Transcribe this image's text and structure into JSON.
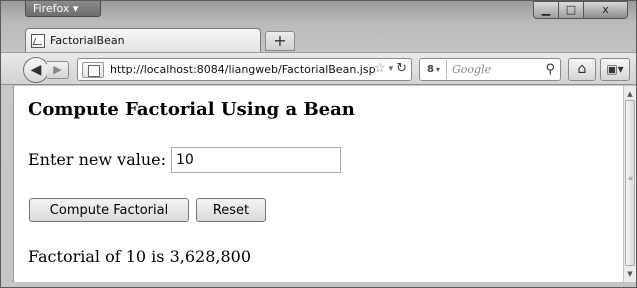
{
  "browser": {
    "app_menu_label": "Firefox ▾",
    "window_controls": {
      "minimize": "▁",
      "maximize": "□",
      "close": "x"
    },
    "tab_title": "FactorialBean",
    "new_tab_label": "+",
    "url": "http://localhost:8084/liangweb/FactorialBean.jsp",
    "search_placeholder": "Google",
    "icons": [
      "back-arrow-icon",
      "forward-arrow-icon",
      "site-icon",
      "star-icon",
      "reload-icon",
      "search-engine-icon",
      "magnifier-icon",
      "home-icon",
      "addon-icon"
    ]
  },
  "page": {
    "heading": "Compute Factorial Using a Bean",
    "input_label": "Enter new value:",
    "input_value": "10",
    "compute_button": "Compute Factorial",
    "reset_button": "Reset",
    "result": "Factorial of 10 is 3,628,800"
  }
}
